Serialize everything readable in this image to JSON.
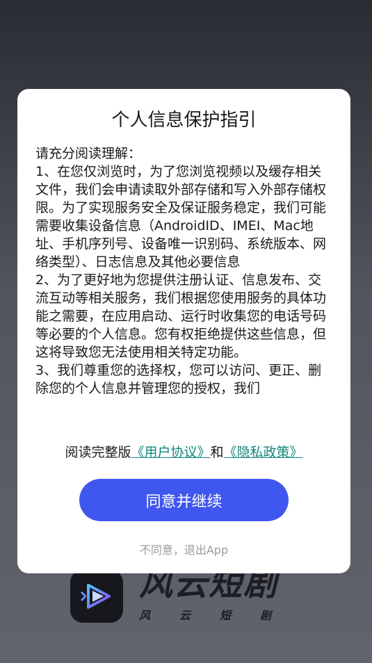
{
  "splash": {
    "app_name": "风云短剧",
    "app_name_sub": [
      "风",
      "云",
      "短",
      "剧"
    ]
  },
  "dialog": {
    "title": "个人信息保护指引",
    "intro": "请充分阅读理解：",
    "paragraphs": [
      "1、在您仅浏览时，为了您浏览视频以及缓存相关文件，我们会申请读取外部存储和写入外部存储权限。为了实现服务安全及保证服务稳定，我们可能需要收集设备信息（AndroidID、IMEI、Mac地址、手机序列号、设备唯一识别码、系统版本、网络类型）、日志信息及其他必要信息",
      "2、为了更好地为您提供注册认证、信息发布、交流互动等相关服务，我们根据您使用服务的具体功能之需要，在应用启动、运行时收集您的电话号码等必要的个人信息。您有权拒绝提供这些信息，但这将导致您无法使用相关特定功能。",
      "3、我们尊重您的选择权，您可以访问、更正、删除您的个人信息并管理您的授权，我们"
    ],
    "links_prefix": "阅读完整版",
    "user_agreement": "《用户协议》",
    "links_and": "和",
    "privacy_policy": "《隐私政策》",
    "agree_label": "同意并继续",
    "disagree_label": "不同意，退出App"
  },
  "colors": {
    "primary_button": "#3f57ee",
    "link": "#11867a",
    "muted_text": "#999999"
  }
}
